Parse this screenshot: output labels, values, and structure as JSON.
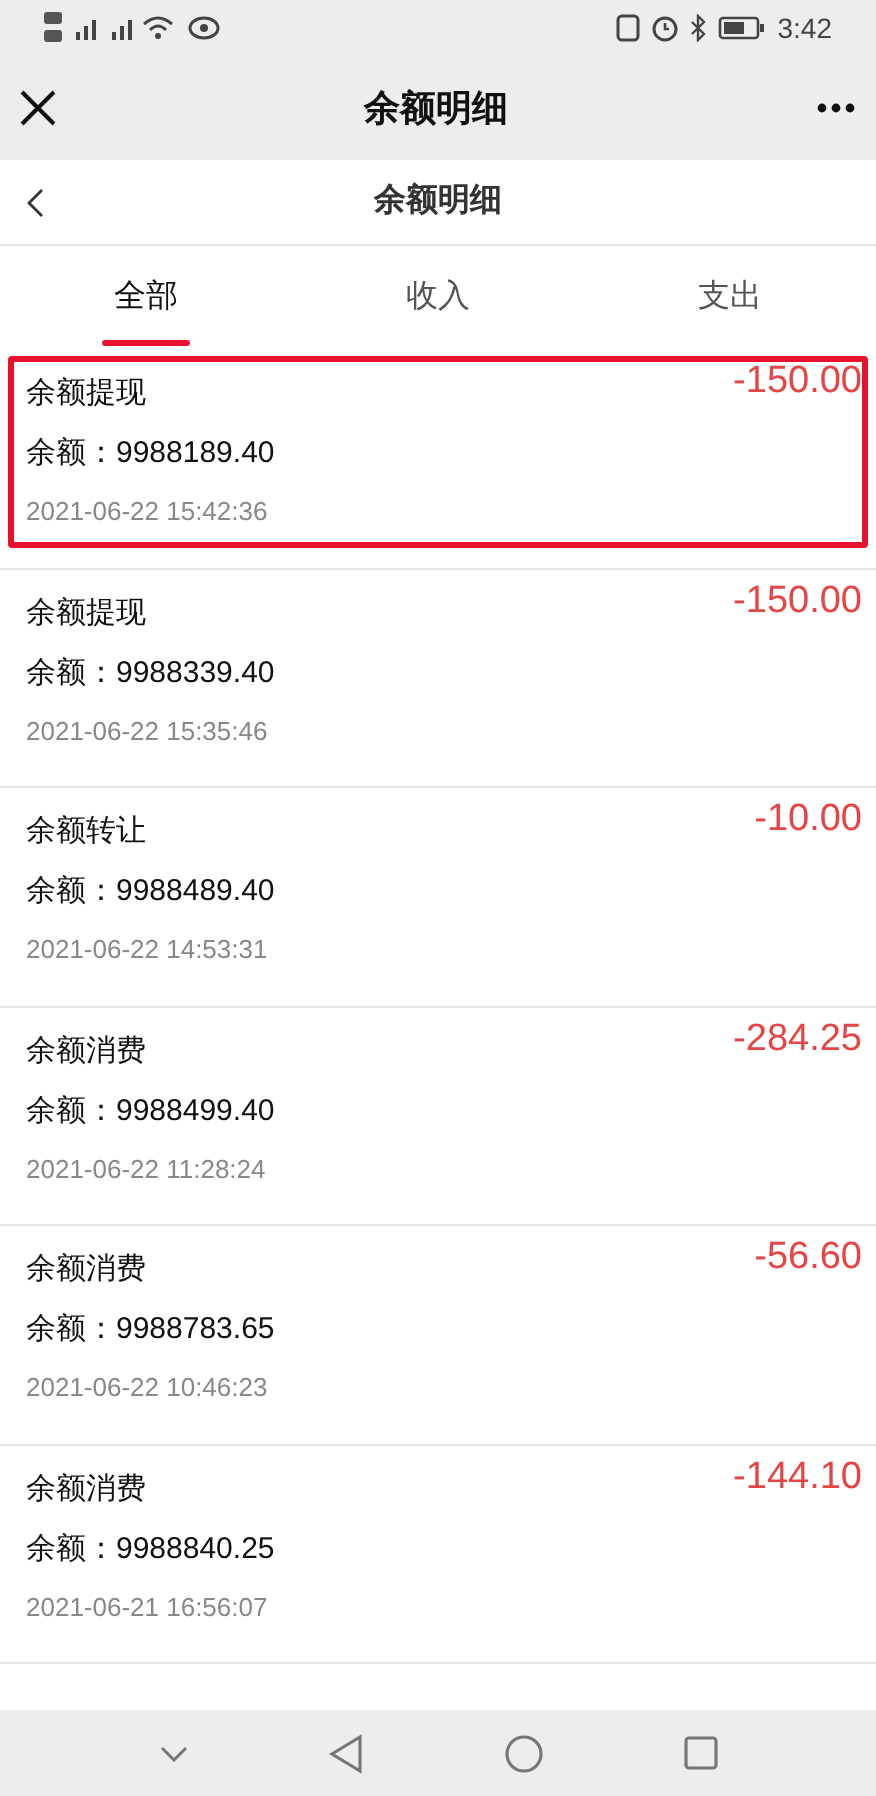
{
  "status_bar": {
    "time": "3:42"
  },
  "header": {
    "title": "余额明细"
  },
  "subheader": {
    "title": "余额明细"
  },
  "tabs": [
    {
      "label": "全部",
      "selected": true
    },
    {
      "label": "收入",
      "selected": false
    },
    {
      "label": "支出",
      "selected": false
    }
  ],
  "records": [
    {
      "title": "余额提现",
      "amount": "-150.00",
      "balance": "余额：9988189.40",
      "time": "2021-06-22 15:42:36",
      "highlighted": true
    },
    {
      "title": "余额提现",
      "amount": "-150.00",
      "balance": "余额：9988339.40",
      "time": "2021-06-22 15:35:46",
      "highlighted": false
    },
    {
      "title": "余额转让",
      "amount": "-10.00",
      "balance": "余额：9988489.40",
      "time": "2021-06-22 14:53:31",
      "highlighted": false
    },
    {
      "title": "余额消费",
      "amount": "-284.25",
      "balance": "余额：9988499.40",
      "time": "2021-06-22 11:28:24",
      "highlighted": false
    },
    {
      "title": "余额消费",
      "amount": "-56.60",
      "balance": "余额：9988783.65",
      "time": "2021-06-22 10:46:23",
      "highlighted": false
    },
    {
      "title": "余额消费",
      "amount": "-144.10",
      "balance": "余额：9988840.25",
      "time": "2021-06-21 16:56:07",
      "highlighted": false
    }
  ]
}
